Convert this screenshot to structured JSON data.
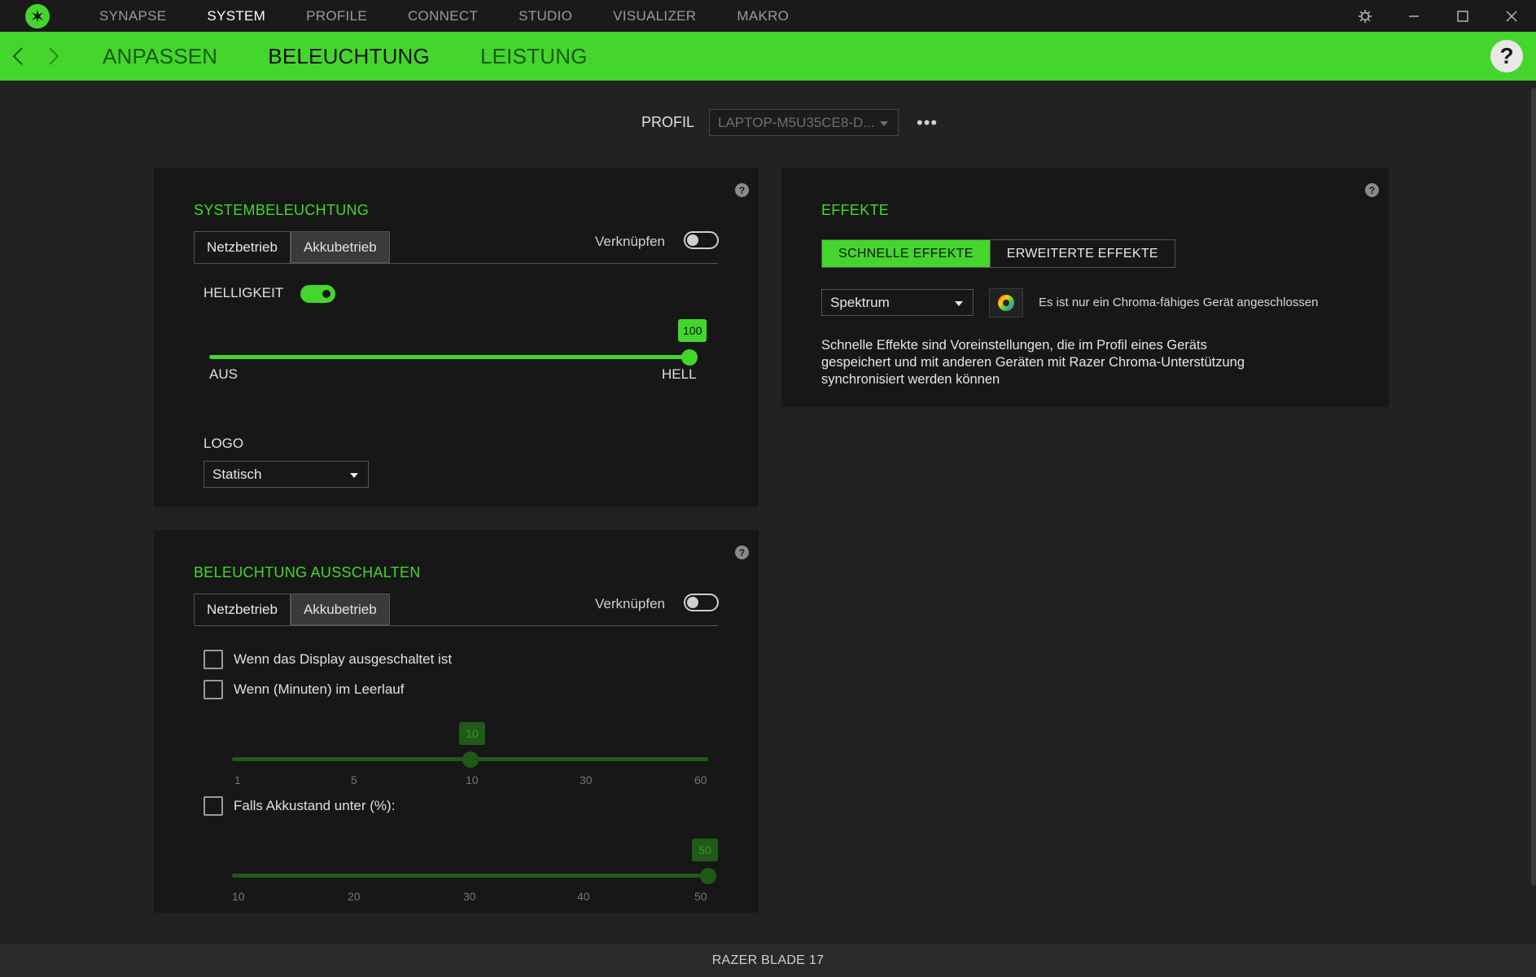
{
  "titlebar": {
    "nav": [
      "SYNAPSE",
      "SYSTEM",
      "PROFILE",
      "CONNECT",
      "STUDIO",
      "VISUALIZER",
      "MAKRO"
    ],
    "active_index": 1
  },
  "subnav": {
    "tabs": [
      "ANPASSEN",
      "BELEUCHTUNG",
      "LEISTUNG"
    ],
    "active_index": 1,
    "help": "?"
  },
  "profile": {
    "label": "PROFIL",
    "value": "LAPTOP-M5U35CE8-D...",
    "more": "•••"
  },
  "system_lighting": {
    "title": "SYSTEMBELEUCHTUNG",
    "tabs": [
      "Netzbetrieb",
      "Akkubetrieb"
    ],
    "link_label": "Verknüpfen",
    "link_on": false,
    "brightness_label": "HELLIGKEIT",
    "brightness_on": true,
    "brightness_value": "100",
    "brightness_fraction": 1.0,
    "min_label": "AUS",
    "max_label": "HELL",
    "logo_label": "LOGO",
    "logo_value": "Statisch"
  },
  "lighting_off": {
    "title": "BELEUCHTUNG AUSSCHALTEN",
    "tabs": [
      "Netzbetrieb",
      "Akkubetrieb"
    ],
    "link_label": "Verknüpfen",
    "link_on": false,
    "display_off_label": "Wenn das Display ausgeschaltet ist",
    "idle_label": "Wenn (Minuten) im Leerlauf",
    "idle_value": "10",
    "idle_ticks": [
      "1",
      "5",
      "10",
      "30",
      "60"
    ],
    "idle_fraction": 0.5,
    "battery_label": "Falls Akkustand unter (%):",
    "battery_value": "50",
    "battery_ticks": [
      "10",
      "20",
      "30",
      "40",
      "50"
    ],
    "battery_fraction": 1.0
  },
  "effects": {
    "title": "EFFEKTE",
    "quick_label": "SCHNELLE EFFEKTE",
    "advanced_label": "ERWEITERTE EFFEKTE",
    "effect_value": "Spektrum",
    "info": "Es ist nur ein Chroma-fähiges Gerät angeschlossen",
    "description": "Schnelle Effekte sind Voreinstellungen, die im Profil eines Geräts gespeichert und mit anderen Geräten mit Razer Chroma-Unterstützung synchronisiert werden können"
  },
  "footer": {
    "device": "RAZER BLADE 17"
  },
  "colors": {
    "accent": "#44d62c",
    "background": "#222222",
    "panel": "#171717"
  }
}
